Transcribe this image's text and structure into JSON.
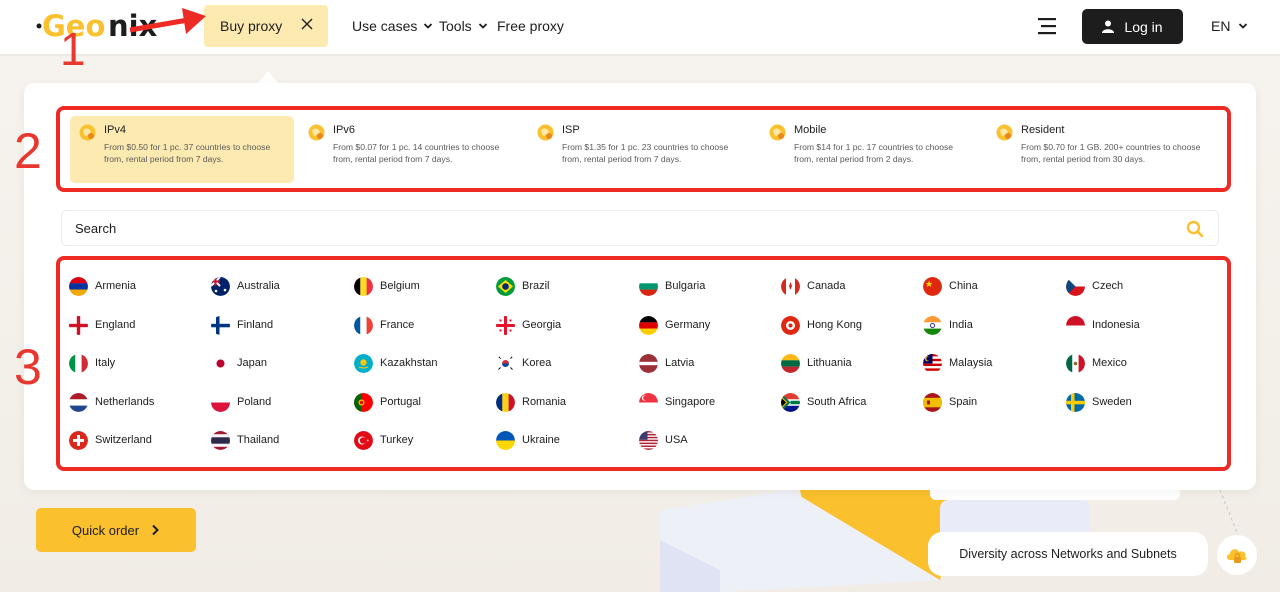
{
  "header": {
    "logo_text": "Geonix",
    "buy_proxy_label": "Buy proxy",
    "nav": [
      {
        "label": "Use cases",
        "has_dropdown": true
      },
      {
        "label": "Tools",
        "has_dropdown": true
      },
      {
        "label": "Free proxy",
        "has_dropdown": false
      }
    ],
    "login_label": "Log in",
    "language": "EN"
  },
  "annotations": [
    "1",
    "2",
    "3"
  ],
  "proxy_types": [
    {
      "name": "IPv4",
      "desc": "From $0.50 for 1 pc. 37 countries to choose from, rental period from 7 days.",
      "active": true
    },
    {
      "name": "IPv6",
      "desc": "From $0.07 for 1 pc. 14 countries to choose from, rental period from 7 days.",
      "active": false
    },
    {
      "name": "ISP",
      "desc": "From $1.35 for 1 pc. 23 countries to choose from, rental period from 7 days.",
      "active": false
    },
    {
      "name": "Mobile",
      "desc": "From $14 for 1 pc. 17 countries to choose from, rental period from 2 days.",
      "active": false
    },
    {
      "name": "Resident",
      "desc": "From $0.70 for 1 GB. 200+ countries to choose from, rental period from 30 days.",
      "active": false
    }
  ],
  "search": {
    "placeholder": "Search"
  },
  "countries": [
    "Armenia",
    "Australia",
    "Belgium",
    "Brazil",
    "Bulgaria",
    "Canada",
    "China",
    "Czech",
    "England",
    "Finland",
    "France",
    "Georgia",
    "Germany",
    "Hong Kong",
    "India",
    "Indonesia",
    "Italy",
    "Japan",
    "Kazakhstan",
    "Korea",
    "Latvia",
    "Lithuania",
    "Malaysia",
    "Mexico",
    "Netherlands",
    "Poland",
    "Portugal",
    "Romania",
    "Singapore",
    "South Africa",
    "Spain",
    "Sweden",
    "Switzerland",
    "Thailand",
    "Turkey",
    "Ukraine",
    "USA"
  ],
  "quick_order_label": "Quick order",
  "diversity_label": "Diversity across Networks and Subnets",
  "colors": {
    "accent": "#fbc02d",
    "active_bg": "#fdeab1",
    "annotation": "#ee2a24",
    "dark": "#1d1d1d"
  }
}
